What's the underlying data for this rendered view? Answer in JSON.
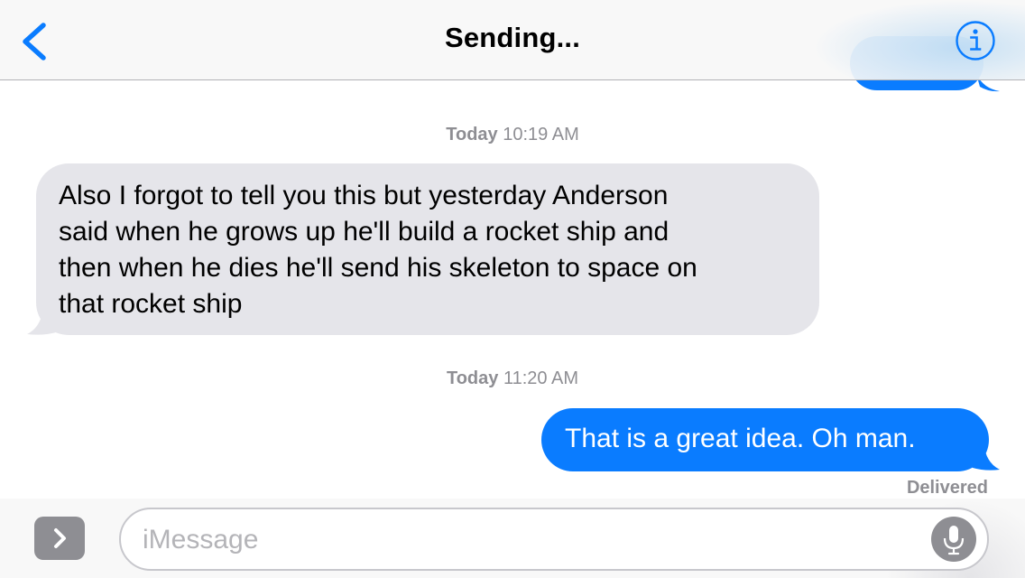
{
  "nav": {
    "title": "Sending...",
    "back_icon": "chevron-left-icon",
    "info_icon": "info-circle-icon"
  },
  "thread": {
    "timestamps": [
      {
        "day": "Today",
        "time": "10:19 AM"
      },
      {
        "day": "Today",
        "time": "11:20 AM"
      }
    ],
    "received": {
      "text": "Also I forgot to tell you this but yesterday Anderson\nsaid when he grows up he'll build a rocket ship and\nthen when he dies he'll send his skeleton to space on\nthat rocket ship"
    },
    "sent": {
      "text": "That is a great idea. Oh man.",
      "status": "Delivered"
    }
  },
  "compose": {
    "placeholder": "iMessage",
    "value": "",
    "expand_icon": "chevron-right-icon",
    "mic_icon": "microphone-icon"
  },
  "colors": {
    "accent": "#0a7cff",
    "received_bubble": "#e5e5ea",
    "secondary_text": "#8e8e93"
  }
}
